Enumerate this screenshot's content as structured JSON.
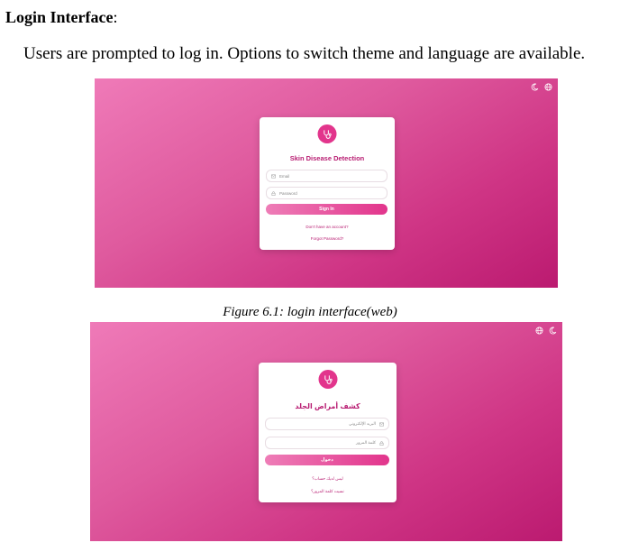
{
  "heading": {
    "title": "Login Interface",
    "suffix": ":"
  },
  "paragraph": "Users are prompted to log in. Options to switch theme and language are available.",
  "caption": "Figure 6.1: login interface(web)",
  "colors": {
    "brand": "#e2358c",
    "title": "#b81d72",
    "gradient_start": "#ef7ab8",
    "gradient_end": "#bb1a70"
  },
  "web_login": {
    "icons": [
      "moon-icon",
      "globe-icon"
    ],
    "logo_icon": "stethoscope-icon",
    "title": "Skin Disease Detection",
    "email_placeholder": "Email",
    "password_placeholder": "Password",
    "signin_label": "Sign In",
    "signup_link": "Don't have an account?",
    "forgot_link": "Forgot Password?"
  },
  "arabic_login": {
    "icons": [
      "globe-icon",
      "moon-icon"
    ],
    "logo_icon": "stethoscope-icon",
    "title": "كشف أمراض الجلد",
    "email_placeholder": "البريد الإلكتروني",
    "password_placeholder": "كلمة المرور",
    "signin_label": "دخول",
    "signup_link": "ليس لديك حساب؟",
    "forgot_link": "نسيت كلمة المرور؟"
  }
}
